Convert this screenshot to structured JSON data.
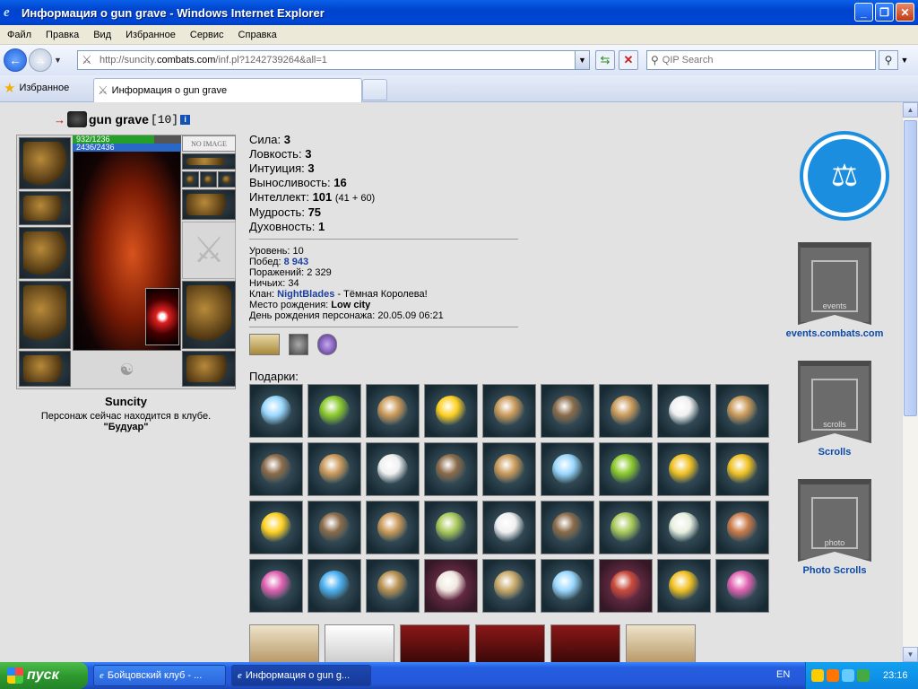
{
  "window": {
    "title": "Информация о gun grave - Windows Internet Explorer",
    "controls": [
      "_",
      "❐",
      "✕"
    ]
  },
  "menu": [
    "Файл",
    "Правка",
    "Вид",
    "Избранное",
    "Сервис",
    "Справка"
  ],
  "address": {
    "prefix": "http://suncity.",
    "domain": "combats.com",
    "path": "/inf.pl?1242739264&all=1"
  },
  "search": {
    "placeholder": "QIP Search"
  },
  "favorites_label": "Избранное",
  "tab": {
    "title": "Информация о gun grave"
  },
  "character": {
    "name": "gun grave",
    "level": "[10]",
    "hp": "932/1236",
    "hp_fraction": 0.754,
    "mp": "2436/2436",
    "mp_fraction": 1.0,
    "no_image": "NO IMAGE",
    "city": "Suncity",
    "location_text": "Персонаж сейчас находится в клубе.",
    "location_room": "\"Будуар\""
  },
  "stats": [
    {
      "label": "Сила:",
      "value": "3",
      "extra": ""
    },
    {
      "label": "Ловкость:",
      "value": "3",
      "extra": ""
    },
    {
      "label": "Интуиция:",
      "value": "3",
      "extra": ""
    },
    {
      "label": "Выносливость:",
      "value": "16",
      "extra": ""
    },
    {
      "label": "Интеллект:",
      "value": "101",
      "extra": "(41 + 60)"
    },
    {
      "label": "Мудрость:",
      "value": "75",
      "extra": ""
    },
    {
      "label": "Духовность:",
      "value": "1",
      "extra": ""
    }
  ],
  "info": {
    "level_label": "Уровень:",
    "level": "10",
    "wins_label": "Побед:",
    "wins": "8 943",
    "losses_label": "Поражений:",
    "losses": "2 329",
    "draws_label": "Ничьих:",
    "draws": "34",
    "clan_label": "Клан:",
    "clan": "NightBlades",
    "clan_title": "- Тёмная Королева!",
    "birthplace_label": "Место рождения:",
    "birthplace": "Low city",
    "birthday_label": "День рождения персонажа:",
    "birthday": "20.05.09 06:21"
  },
  "gifts_title": "Подарки:",
  "gifts": [
    {
      "kind": "blue",
      "color": "#9ad8ff"
    },
    {
      "kind": "lime",
      "color": "#8ac82a"
    },
    {
      "kind": "bronze",
      "color": "#c89858"
    },
    {
      "kind": "smiley",
      "color": "#ffd020"
    },
    {
      "kind": "bronze",
      "color": "#c89858"
    },
    {
      "kind": "hedgehog",
      "color": "#8a6a48"
    },
    {
      "kind": "bronze",
      "color": "#c89858"
    },
    {
      "kind": "penguin",
      "color": "#f0f0f0"
    },
    {
      "kind": "bronze",
      "color": "#c89858"
    },
    {
      "kind": "hedgehog",
      "color": "#8a6a48"
    },
    {
      "kind": "bronze",
      "color": "#c89858"
    },
    {
      "kind": "penguin",
      "color": "#f0f0f0"
    },
    {
      "kind": "hedgehog",
      "color": "#8a6a48"
    },
    {
      "kind": "bronze",
      "color": "#c89858"
    },
    {
      "kind": "blue",
      "color": "#9ad8ff"
    },
    {
      "kind": "lime",
      "color": "#8ac82a"
    },
    {
      "kind": "bell",
      "color": "#f0c020"
    },
    {
      "kind": "bell",
      "color": "#f0c020"
    },
    {
      "kind": "smiley",
      "color": "#ffd020"
    },
    {
      "kind": "hedgehog",
      "color": "#8a6a48"
    },
    {
      "kind": "bronze",
      "color": "#c89858"
    },
    {
      "kind": "mirror",
      "color": "#a8c858"
    },
    {
      "kind": "penguin",
      "color": "#f0f0f0"
    },
    {
      "kind": "hedgehog",
      "color": "#8a6a48"
    },
    {
      "kind": "mirror",
      "color": "#a8c858"
    },
    {
      "kind": "ball",
      "color": "#e8f0e0"
    },
    {
      "kind": "hat",
      "color": "#c87848"
    },
    {
      "kind": "flower",
      "color": "#e060b0"
    },
    {
      "kind": "blue",
      "color": "#4ab0f0"
    },
    {
      "kind": "statue",
      "color": "#b89050"
    },
    {
      "kind": "book",
      "color": "#f0e8e0",
      "pink": true
    },
    {
      "kind": "shield",
      "color": "#c8a868"
    },
    {
      "kind": "blue",
      "color": "#9ad8ff"
    },
    {
      "kind": "drum",
      "color": "#c84a3a",
      "pink": true
    },
    {
      "kind": "rose",
      "color": "#f0c020"
    },
    {
      "kind": "flower",
      "color": "#e060b0"
    }
  ],
  "right_links": {
    "events": "events.combats.com",
    "scrolls": "Scrolls",
    "photo": "Photo Scrolls",
    "events_banner_text": "events",
    "scrolls_banner_text": "scrolls",
    "photo_banner_text": "photo"
  },
  "taskbar": {
    "start": "пуск",
    "task1": "Бойцовский клуб - ...",
    "task2": "Информация о gun g...",
    "lang": "EN",
    "clock": "23:16"
  }
}
